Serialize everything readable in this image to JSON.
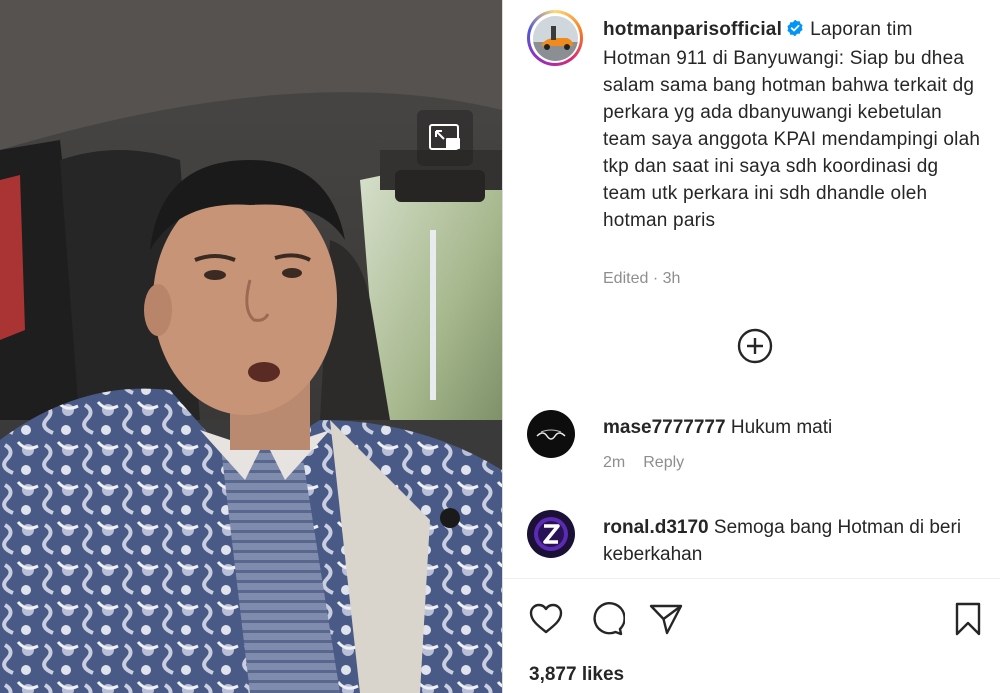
{
  "post": {
    "username": "hotmanparisofficial",
    "verified": true,
    "caption": "Laporan tim Hotman 911 di Banyuwangi: Siap bu dhea salam sama bang hotman bahwa terkait dg perkara yg ada dbanyuwangi kebetulan team saya anggota KPAI mendampingi olah tkp dan saat ini saya sdh koordinasi dg team utk perkara ini sdh dhandle oleh hotman paris",
    "meta": "Edited · 3h"
  },
  "comments": [
    {
      "username": "mase7777777",
      "text": "Hukum mati",
      "time": "2m",
      "reply": "Reply"
    },
    {
      "username": "ronal.d3170",
      "text": "Semoga bang Hotman di beri keberkahan"
    }
  ],
  "likes": "3,877 likes",
  "icons": {
    "media_button": "picture-in-picture-icon",
    "more": "plus-circle-icon",
    "like": "heart-icon",
    "comment": "comment-bubble-icon",
    "share": "paper-plane-icon",
    "save": "bookmark-icon"
  },
  "colors": {
    "verified": "#0095f6",
    "muted": "#8e8e8e",
    "text": "#262626"
  }
}
